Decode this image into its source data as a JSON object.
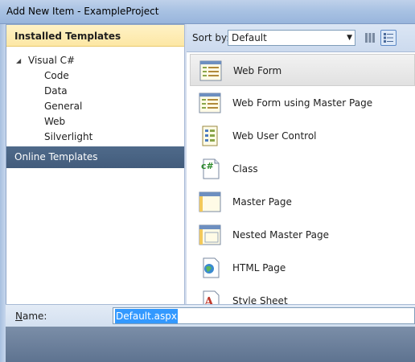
{
  "window": {
    "title": "Add New Item - ExampleProject"
  },
  "left_pane": {
    "installed_header": "Installed Templates",
    "tree": {
      "root": "Visual C#",
      "children": [
        "Code",
        "Data",
        "General",
        "Web",
        "Silverlight"
      ]
    },
    "online_header": "Online Templates"
  },
  "toolbar": {
    "sort_label": "Sort by:",
    "sort_value": "Default",
    "view_buttons": [
      "small-icons-view",
      "medium-icons-view"
    ]
  },
  "templates": [
    {
      "label": "Web Form",
      "icon": "web-form-icon",
      "selected": true
    },
    {
      "label": "Web Form using Master Page",
      "icon": "web-form-master-icon",
      "selected": false
    },
    {
      "label": "Web User Control",
      "icon": "web-user-control-icon",
      "selected": false
    },
    {
      "label": "Class",
      "icon": "csharp-class-icon",
      "selected": false
    },
    {
      "label": "Master Page",
      "icon": "master-page-icon",
      "selected": false
    },
    {
      "label": "Nested Master Page",
      "icon": "nested-master-page-icon",
      "selected": false
    },
    {
      "label": "HTML Page",
      "icon": "html-page-icon",
      "selected": false
    },
    {
      "label": "Style Sheet",
      "icon": "style-sheet-icon",
      "selected": false
    }
  ],
  "name_field": {
    "label_prefix": "N",
    "label_rest": "ame:",
    "value": "Default.aspx"
  },
  "colors": {
    "installed_header_bg": "#fde7a5",
    "online_header_bg": "#4a6483",
    "selection_blue": "#3399ff"
  }
}
